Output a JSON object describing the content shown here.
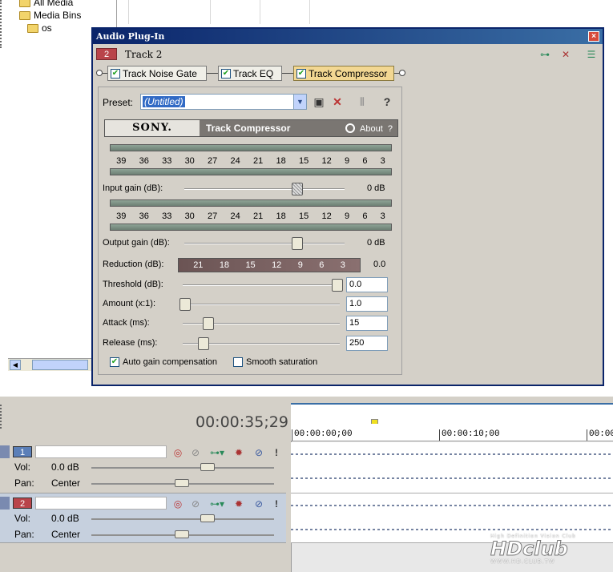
{
  "tree": {
    "items": [
      {
        "label": "All Media"
      },
      {
        "label": "Media Bins"
      },
      {
        "label": "os"
      }
    ]
  },
  "dialog": {
    "title": "Audio Plug-In",
    "close_icon": "close-icon",
    "track_number": "2",
    "track_name": "Track 2",
    "chain": [
      {
        "label": "Track Noise Gate",
        "checked": true
      },
      {
        "label": "Track EQ",
        "checked": true
      },
      {
        "label": "Track Compressor",
        "checked": true,
        "selected": true
      }
    ],
    "preset_label": "Preset:",
    "preset_value": "(Untitled)",
    "plugin": {
      "brand": "SONY.",
      "name": "Track Compressor",
      "about": "About",
      "help": "?"
    },
    "scale": [
      "39",
      "36",
      "33",
      "30",
      "27",
      "24",
      "21",
      "18",
      "15",
      "12",
      "9",
      "6",
      "3"
    ],
    "reduction_scale": [
      "21",
      "18",
      "15",
      "12",
      "9",
      "6",
      "3"
    ],
    "input_gain": {
      "label": "Input gain (dB):",
      "value": "0 dB",
      "level": 0.72
    },
    "output_gain": {
      "label": "Output gain (dB):",
      "value": "0 dB",
      "level": 0.72
    },
    "reduction": {
      "label": "Reduction (dB):",
      "value": "0.0"
    },
    "threshold": {
      "label": "Threshold (dB):",
      "value": "0.0",
      "level": 1.0
    },
    "amount": {
      "label": "Amount (x:1):",
      "value": "1.0",
      "level": 0.0
    },
    "attack": {
      "label": "Attack (ms):",
      "value": "15",
      "level": 0.15
    },
    "release": {
      "label": "Release (ms):",
      "value": "250",
      "level": 0.12
    },
    "auto_gain": {
      "label": "Auto gain compensation",
      "checked": true
    },
    "smooth_sat": {
      "label": "Smooth saturation",
      "checked": false
    }
  },
  "timeline": {
    "timecode": "00:00:35;29",
    "ruler": [
      "00:00:00;00",
      "00:00:10;00",
      "00:00"
    ],
    "tracks": [
      {
        "number": "1",
        "vol_label": "Vol:",
        "vol": "0.0 dB",
        "pan_label": "Pan:",
        "pan": "Center",
        "color": "#5b7fb8"
      },
      {
        "number": "2",
        "vol_label": "Vol:",
        "vol": "0.0 dB",
        "pan_label": "Pan:",
        "pan": "Center",
        "color": "#b9444a"
      }
    ]
  },
  "watermark": {
    "tagline": "High Definition Vision Club",
    "logo": "HDclub",
    "url": "WWW.HD.CLUB.TW"
  },
  "colors": {
    "title_bar": "#0a246a",
    "selected_fx": "#f2d792",
    "track2": "#b9444a"
  }
}
